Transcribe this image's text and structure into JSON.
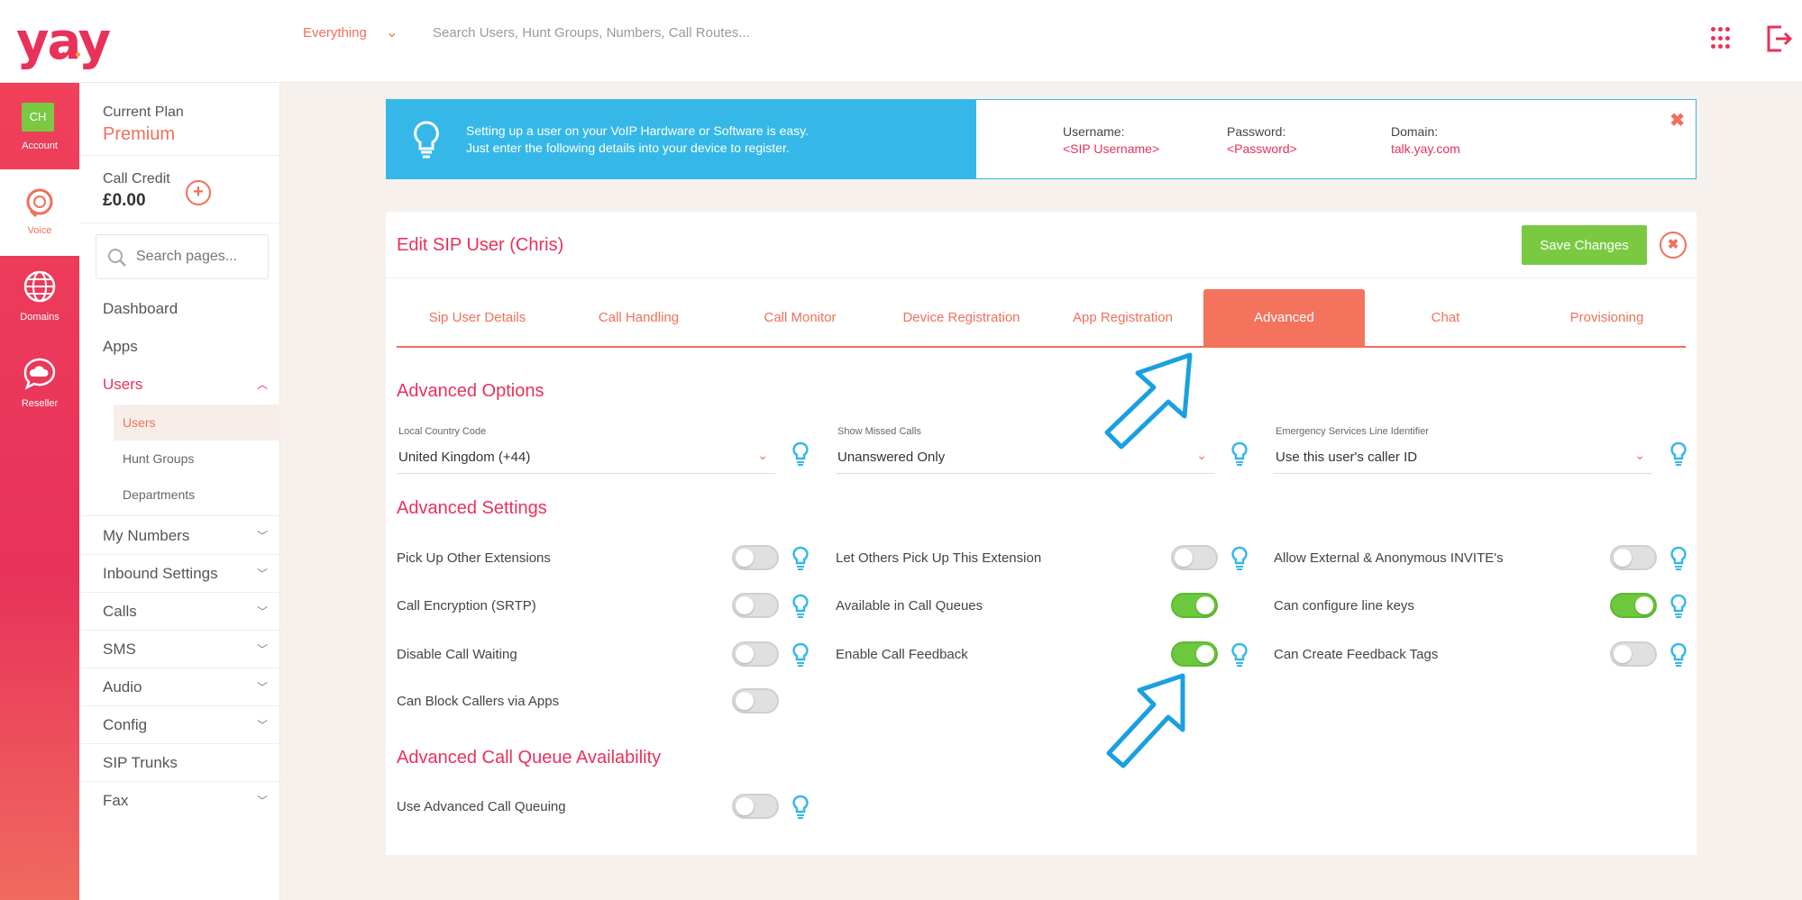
{
  "topbar": {
    "logo": "yay",
    "scope_label": "Everything",
    "search_placeholder": "Search Users, Hunt Groups, Numbers, Call Routes..."
  },
  "rail": {
    "account": {
      "initials": "CH",
      "label": "Account"
    },
    "voice": {
      "label": "Voice"
    },
    "domains": {
      "label": "Domains"
    },
    "reseller": {
      "label": "Reseller"
    }
  },
  "sidebar": {
    "plan_label": "Current Plan",
    "plan_value": "Premium",
    "credit_label": "Call Credit",
    "credit_value": "£0.00",
    "credit_add": "+",
    "search_placeholder": "Search pages...",
    "items": [
      {
        "label": "Dashboard",
        "chevron": ""
      },
      {
        "label": "Apps",
        "chevron": ""
      },
      {
        "label": "Users",
        "chevron": "^"
      },
      {
        "label": "My Numbers",
        "chevron": "v"
      },
      {
        "label": "Inbound Settings",
        "chevron": "v"
      },
      {
        "label": "Calls",
        "chevron": "v"
      },
      {
        "label": "SMS",
        "chevron": "v"
      },
      {
        "label": "Audio",
        "chevron": "v"
      },
      {
        "label": "Config",
        "chevron": "v"
      },
      {
        "label": "SIP Trunks",
        "chevron": ""
      },
      {
        "label": "Fax",
        "chevron": "v"
      }
    ],
    "sub_items": [
      "Users",
      "Hunt Groups",
      "Departments"
    ]
  },
  "banner": {
    "line1": "Setting up a user on your VoIP Hardware or Software is easy.",
    "line2": "Just enter the following details into your device to register.",
    "username_label": "Username:",
    "username_value": "<SIP Username>",
    "password_label": "Password:",
    "password_value": "<Password>",
    "domain_label": "Domain:",
    "domain_value": "talk.yay.com",
    "close": "✖"
  },
  "editor": {
    "title": "Edit SIP User (Chris)",
    "save_label": "Save Changes",
    "close": "✖",
    "tabs": [
      "Sip User Details",
      "Call Handling",
      "Call Monitor",
      "Device Registration",
      "App Registration",
      "Advanced",
      "Chat",
      "Provisioning"
    ],
    "active_tab": "Advanced"
  },
  "advanced_options": {
    "title": "Advanced Options",
    "selects": [
      {
        "label": "Local Country Code",
        "value": "United Kingdom (+44)"
      },
      {
        "label": "Show Missed Calls",
        "value": "Unanswered Only"
      },
      {
        "label": "Emergency Services Line Identifier",
        "value": "Use this user's caller ID"
      }
    ]
  },
  "advanced_settings": {
    "title": "Advanced Settings",
    "options": [
      {
        "label": "Pick Up Other Extensions",
        "on": false,
        "hint": true
      },
      {
        "label": "Let Others Pick Up This Extension",
        "on": false,
        "hint": true
      },
      {
        "label": "Allow External & Anonymous INVITE's",
        "on": false,
        "hint": true
      },
      {
        "label": "Call Encryption (SRTP)",
        "on": false,
        "hint": true
      },
      {
        "label": "Available in Call Queues",
        "on": true,
        "hint": false
      },
      {
        "label": "Can configure line keys",
        "on": true,
        "hint": true
      },
      {
        "label": "Disable Call Waiting",
        "on": false,
        "hint": true
      },
      {
        "label": "Enable Call Feedback",
        "on": true,
        "hint": true
      },
      {
        "label": "Can Create Feedback Tags",
        "on": false,
        "hint": true
      },
      {
        "label": "Can Block Callers via Apps",
        "on": false,
        "hint": false
      }
    ]
  },
  "call_queue": {
    "title": "Advanced Call Queue Availability",
    "options": [
      {
        "label": "Use Advanced Call Queuing",
        "on": false,
        "hint": true
      }
    ]
  },
  "colors": {
    "brand": "#e8325a",
    "accent": "#f0705a",
    "info": "#35b8e8",
    "success": "#7ac943"
  }
}
